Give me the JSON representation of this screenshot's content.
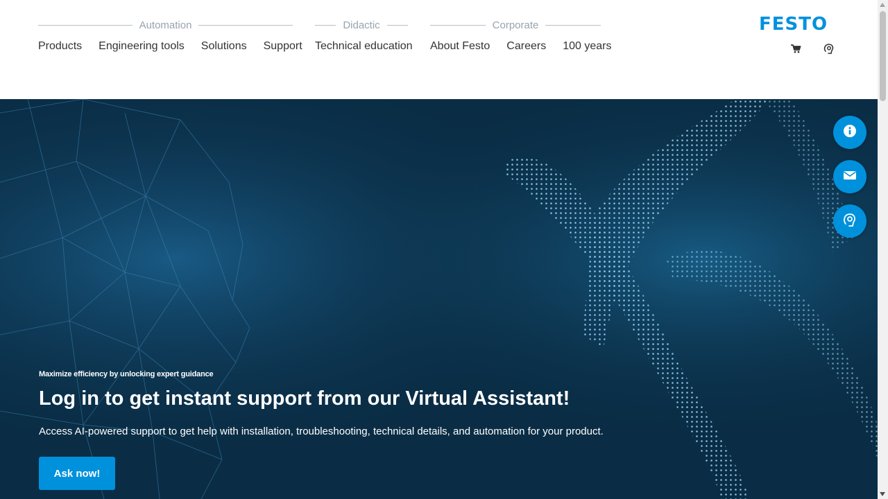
{
  "header": {
    "logo": "FESTO",
    "groups": [
      {
        "title": "Automation",
        "links": [
          "Products",
          "Engineering tools",
          "Solutions",
          "Support"
        ]
      },
      {
        "title": "Didactic",
        "links": [
          "Technical education"
        ]
      },
      {
        "title": "Corporate",
        "links": [
          "About Festo",
          "Careers",
          "100 years"
        ]
      }
    ],
    "icons": [
      "cart-icon",
      "assistant-icon"
    ]
  },
  "hero": {
    "eyebrow": "Maximize efficiency by unlocking expert guidance",
    "title": "Log in to get instant support from our Virtual Assistant!",
    "text": "Access AI-powered support to get help with installation, troubleshooting, technical details, and automation for your product.",
    "button_label": "Ask now!"
  },
  "fabs": [
    "info-icon",
    "mail-icon",
    "assistant-icon"
  ],
  "colors": {
    "brand": "#0091dc",
    "hero_bg": "#0a2d45",
    "nav_text": "#333333",
    "group_title": "#98a3ad"
  }
}
